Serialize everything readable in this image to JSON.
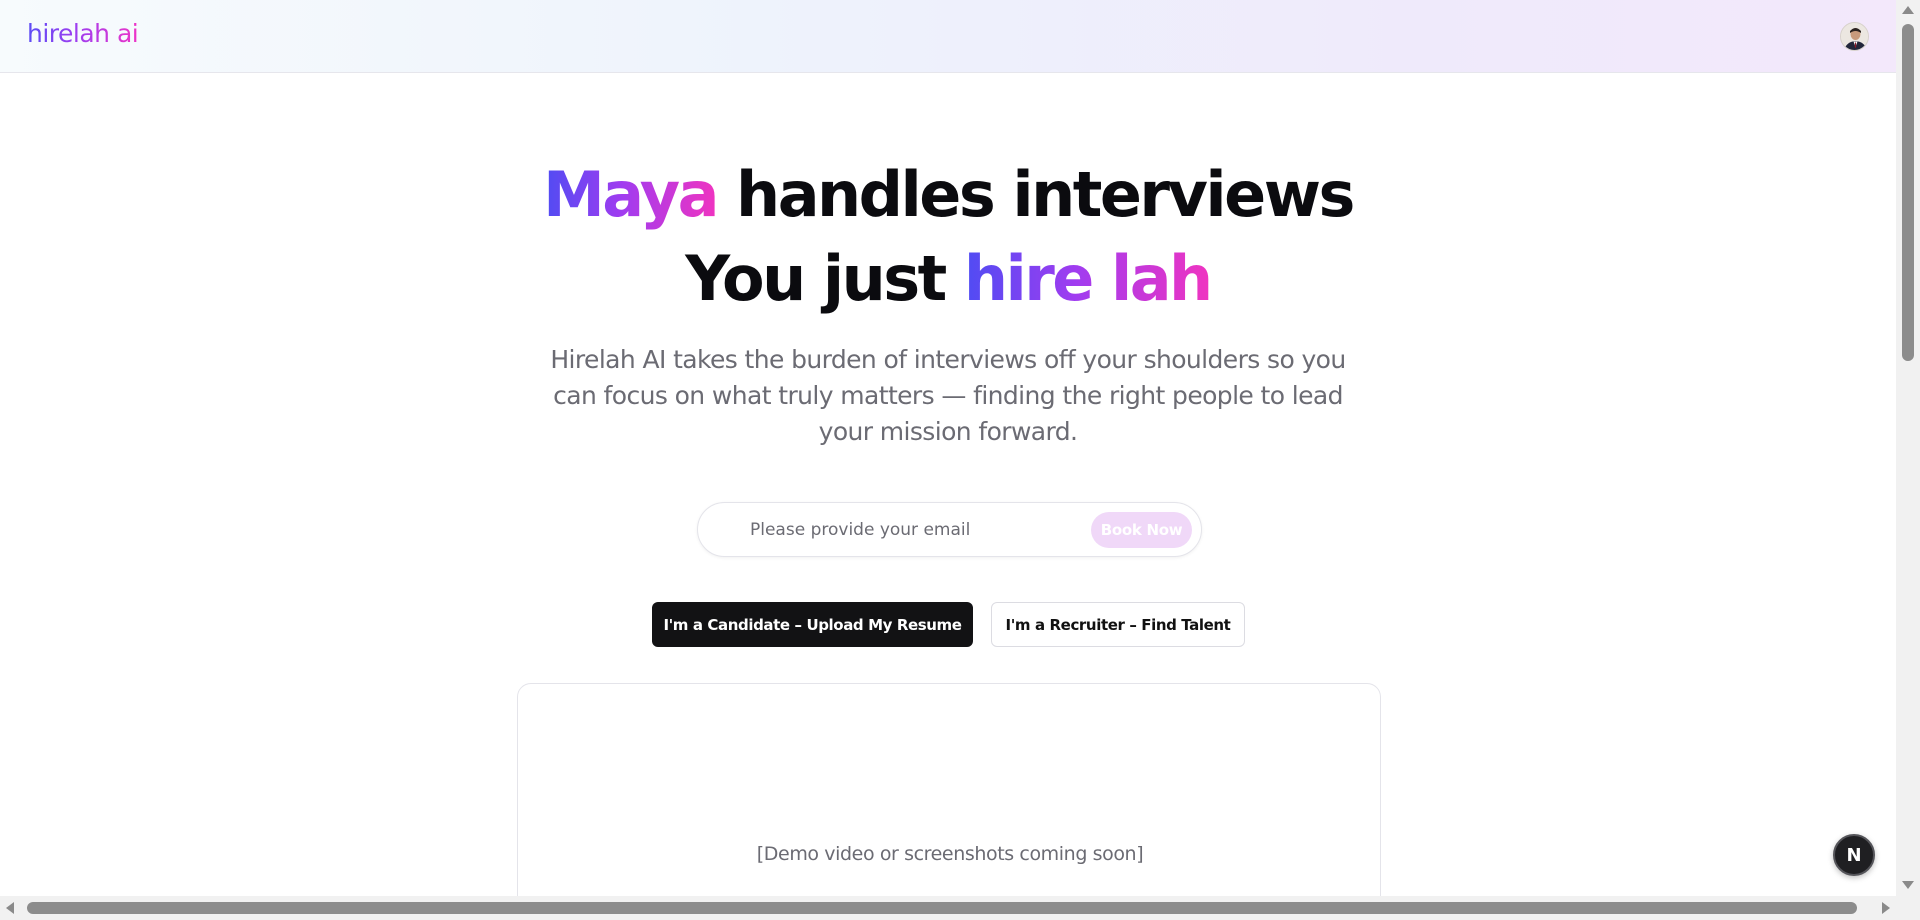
{
  "header": {
    "logo_text": "hirelah ai",
    "avatar_icon": "user-avatar-icon"
  },
  "hero": {
    "line1_highlight": "Maya",
    "line1_rest": " handles interviews",
    "line2_start": "You just ",
    "line2_highlight": "hire lah",
    "subtitle": "Hirelah AI takes the burden of interviews off your shoulders so you can focus on what truly matters — finding the right people to lead your mission forward."
  },
  "email_form": {
    "placeholder": "Please provide your email",
    "value": "",
    "button_label": "Book Now"
  },
  "roles": {
    "candidate_label": "I'm a Candidate – Upload My Resume",
    "recruiter_label": "I'm a Recruiter – Find Talent"
  },
  "demo": {
    "placeholder_text": "[Demo video or screenshots coming soon]"
  },
  "fab": {
    "label": "N",
    "icon": "next-logo-icon"
  },
  "colors": {
    "gradient_start": "#4f4cf3",
    "gradient_mid": "#a03cf0",
    "gradient_end": "#f034c0",
    "primary_dark": "#121214",
    "book_button_bg": "#f0d8f8",
    "muted_text": "#6b6b73"
  }
}
